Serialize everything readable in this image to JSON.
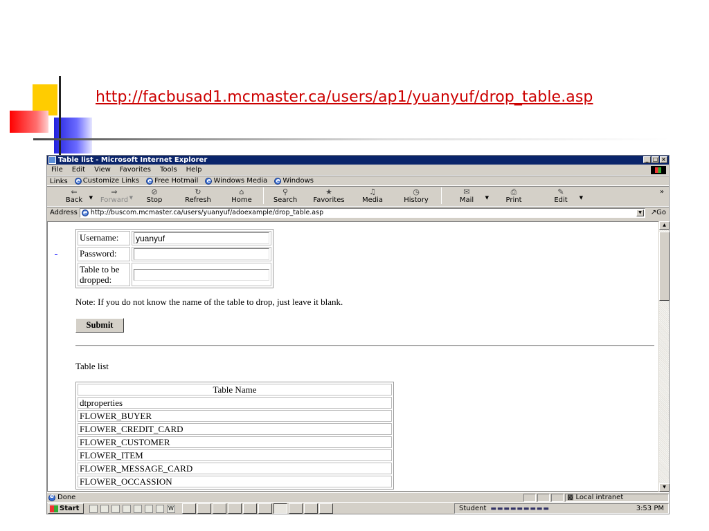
{
  "slide": {
    "url_text": "http://facbusad1.mcmaster.ca/users/ap1/yuanyuf/drop_table.asp"
  },
  "window": {
    "title": "Table list - Microsoft Internet Explorer",
    "controls": [
      "_",
      "□",
      "×"
    ]
  },
  "menu": [
    "File",
    "Edit",
    "View",
    "Favorites",
    "Tools",
    "Help"
  ],
  "links_bar": {
    "label": "Links",
    "items": [
      "Customize Links",
      "Free Hotmail",
      "Windows Media",
      "Windows"
    ]
  },
  "toolbar": {
    "back": "Back",
    "forward": "Forward",
    "stop": "Stop",
    "refresh": "Refresh",
    "home": "Home",
    "search": "Search",
    "favorites": "Favorites",
    "media": "Media",
    "history": "History",
    "mail": "Mail",
    "print": "Print",
    "edit": "Edit",
    "more": "»"
  },
  "address": {
    "label": "Address",
    "value": "http://buscom.mcmaster.ca/users/yuanyuf/adoexample/drop_table.asp",
    "go": "Go"
  },
  "form": {
    "username_label": "Username:",
    "username_value": "yuanyuf",
    "password_label": "Password:",
    "password_value": "",
    "table_label": "Table to be dropped:",
    "table_value": "",
    "note": "Note: If you do not know the name of the table to drop, just leave it blank.",
    "submit": "Submit"
  },
  "table_list": {
    "title": "Table list",
    "header": "Table Name",
    "rows": [
      "dtproperties",
      "FLOWER_BUYER",
      "FLOWER_CREDIT_CARD",
      "FLOWER_CUSTOMER",
      "FLOWER_ITEM",
      "FLOWER_MESSAGE_CARD",
      "FLOWER_OCCASSION"
    ]
  },
  "status": {
    "text": "Done",
    "zone": "Local intranet"
  },
  "taskbar": {
    "start": "Start",
    "user": "Student",
    "time": "3:53 PM"
  },
  "colors": {
    "title_bar": "#0a246a",
    "slide_link": "#cc0000",
    "chrome": "#d4d0c8"
  }
}
